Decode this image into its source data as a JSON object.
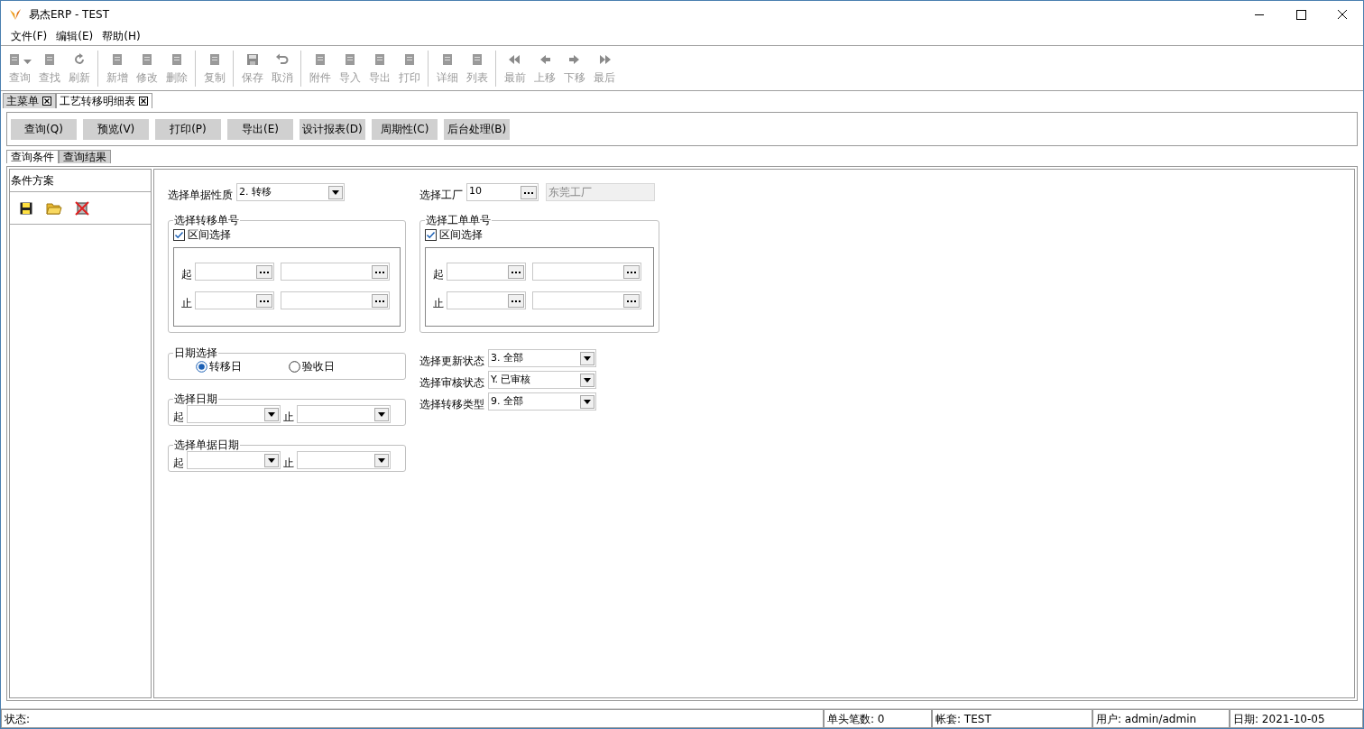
{
  "window": {
    "title": "易杰ERP - TEST"
  },
  "menu": [
    {
      "label": "文件(F)"
    },
    {
      "label": "编辑(E)"
    },
    {
      "label": "帮助(H)"
    }
  ],
  "toolbar": {
    "groups": [
      [
        {
          "label": "查询",
          "disabled": true,
          "dropdown": true
        },
        {
          "label": "查找",
          "disabled": true
        },
        {
          "label": "刷新",
          "disabled": true
        }
      ],
      [
        {
          "label": "新增",
          "disabled": true
        },
        {
          "label": "修改",
          "disabled": true
        },
        {
          "label": "删除",
          "disabled": true
        }
      ],
      [
        {
          "label": "复制",
          "disabled": true
        }
      ],
      [
        {
          "label": "保存",
          "disabled": true
        },
        {
          "label": "取消",
          "disabled": true
        }
      ],
      [
        {
          "label": "附件",
          "disabled": true
        },
        {
          "label": "导入",
          "disabled": true
        },
        {
          "label": "导出",
          "disabled": true
        },
        {
          "label": "打印",
          "disabled": true
        }
      ],
      [
        {
          "label": "详细",
          "disabled": true
        },
        {
          "label": "列表",
          "disabled": true
        }
      ],
      [
        {
          "label": "最前",
          "disabled": true
        },
        {
          "label": "上移",
          "disabled": true
        },
        {
          "label": "下移",
          "disabled": true
        },
        {
          "label": "最后",
          "disabled": true
        }
      ]
    ]
  },
  "doc_tabs": [
    {
      "label": "主菜单",
      "selected": false
    },
    {
      "label": "工艺转移明细表",
      "selected": true
    }
  ],
  "action_buttons": [
    {
      "label": "查询(Q)"
    },
    {
      "label": "预览(V)"
    },
    {
      "label": "打印(P)"
    },
    {
      "label": "导出(E)"
    },
    {
      "label": "设计报表(D)"
    },
    {
      "label": "周期性(C)"
    },
    {
      "label": "后台处理(B)"
    }
  ],
  "query_tabs": [
    {
      "label": "查询条件",
      "selected": true
    },
    {
      "label": "查询结果",
      "selected": false
    }
  ],
  "scheme_panel": {
    "title": "条件方案"
  },
  "form": {
    "doc_type": {
      "label": "选择单据性质",
      "value": "2. 转移"
    },
    "factory": {
      "label": "选择工厂",
      "code": "10",
      "name": "东莞工厂"
    },
    "number_groups": [
      {
        "title": "选择转移单号",
        "range": {
          "label": "区间选择",
          "checked": true
        },
        "rows": [
          {
            "label": "起"
          },
          {
            "label": "止"
          }
        ]
      },
      {
        "title": "选择工单单号",
        "range": {
          "label": "区间选择",
          "checked": true
        },
        "rows": [
          {
            "label": "起"
          },
          {
            "label": "止"
          }
        ]
      }
    ],
    "date_type": {
      "title": "日期选择",
      "options": [
        {
          "label": "转移日",
          "selected": true
        },
        {
          "label": "验收日",
          "selected": false
        }
      ]
    },
    "date_ranges": [
      {
        "title": "选择日期",
        "from_label": "起",
        "to_label": "止"
      },
      {
        "title": "选择单据日期",
        "from_label": "起",
        "to_label": "止"
      }
    ],
    "selects": [
      {
        "label": "选择更新状态",
        "value": "3. 全部"
      },
      {
        "label": "选择审核状态",
        "value": "Y. 已审核"
      },
      {
        "label": "选择转移类型",
        "value": "9. 全部"
      }
    ]
  },
  "status_bar": [
    {
      "text": "状态:"
    },
    {
      "text": "单头笔数: 0"
    },
    {
      "text": "帐套: TEST"
    },
    {
      "text": "用户: admin/admin"
    },
    {
      "text": "日期: 2021-10-05"
    }
  ]
}
